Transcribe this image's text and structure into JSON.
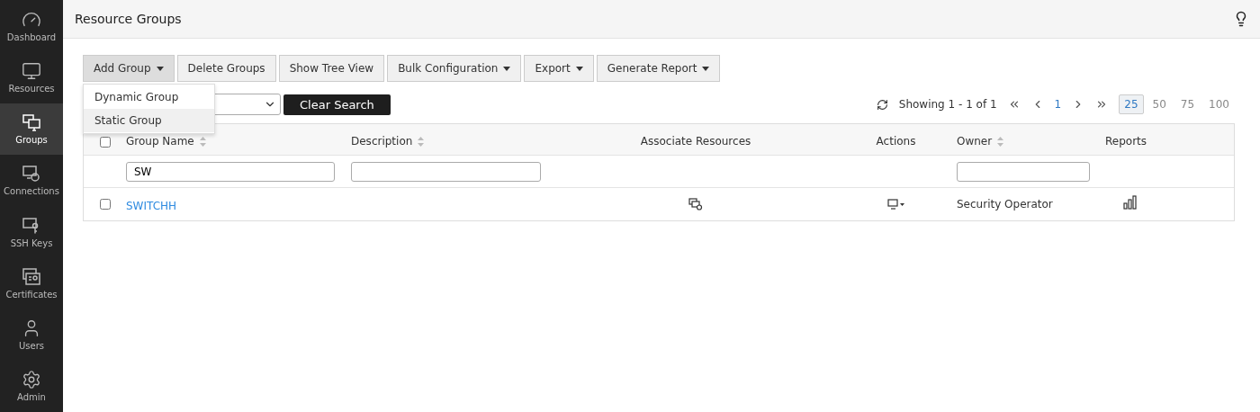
{
  "sidebar": {
    "items": [
      {
        "kind": "dashboard",
        "label": "Dashboard",
        "selected": false
      },
      {
        "kind": "resources",
        "label": "Resources",
        "selected": false
      },
      {
        "kind": "groups",
        "label": "Groups",
        "selected": true
      },
      {
        "kind": "connections",
        "label": "Connections",
        "selected": false
      },
      {
        "kind": "keys",
        "label": "SSH Keys",
        "selected": false
      },
      {
        "kind": "certificates",
        "label": "Certificates",
        "selected": false
      },
      {
        "kind": "users",
        "label": "Users",
        "selected": false
      },
      {
        "kind": "admin",
        "label": "Admin",
        "selected": false
      }
    ]
  },
  "header": {
    "title": "Resource Groups"
  },
  "toolbar": {
    "buttons": [
      {
        "label": "Add Group",
        "dropdown": true,
        "expanded": true
      },
      {
        "label": "Delete Groups",
        "dropdown": false,
        "expanded": false
      },
      {
        "label": "Show Tree View",
        "dropdown": false,
        "expanded": false
      },
      {
        "label": "Bulk Configuration",
        "dropdown": true,
        "expanded": false
      },
      {
        "label": "Export",
        "dropdown": true,
        "expanded": false
      },
      {
        "label": "Generate Report",
        "dropdown": true,
        "expanded": false
      }
    ]
  },
  "menu": {
    "items": [
      {
        "label": "Dynamic Group",
        "selected": false
      },
      {
        "label": "Static Group",
        "selected": true
      }
    ]
  },
  "search": {
    "clear_button": "Clear Search"
  },
  "pagination": {
    "showing": "Showing 1 - 1 of 1",
    "page": "1",
    "page_sizes": [
      {
        "label": "25",
        "selected": true
      },
      {
        "label": "50",
        "selected": false
      },
      {
        "label": "75",
        "selected": false
      },
      {
        "label": "100",
        "selected": false
      }
    ]
  },
  "table": {
    "select_all_checked": false,
    "columns": [
      {
        "label": "Group Name",
        "sortable": true,
        "filter_field": true,
        "filter": "SW"
      },
      {
        "label": "Description",
        "sortable": true,
        "filter_field": true
      },
      {
        "label": "Associate Resources",
        "sortable": false,
        "filter_field": false
      },
      {
        "label": "Actions",
        "sortable": false,
        "filter_field": false
      },
      {
        "label": "Owner",
        "sortable": true,
        "filter_field": true
      },
      {
        "label": "Reports",
        "sortable": false,
        "filter_field": false
      }
    ],
    "rows": [
      {
        "checked": false,
        "name": "SWITCHH",
        "owner": "Security Operator"
      }
    ]
  }
}
